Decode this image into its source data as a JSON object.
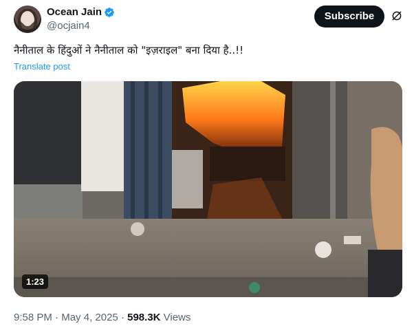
{
  "author": {
    "display_name": "Ocean Jain",
    "handle": "@ocjain4",
    "verified": true,
    "avatar_icon": "profile-photo"
  },
  "actions": {
    "subscribe_label": "Subscribe",
    "grok_icon": "grok-slash-circle-icon"
  },
  "tweet": {
    "text": "नैनीताल के हिंदुओं ने नैनीताल को \"इज़राइल\" बना दिया है..!!",
    "translate_label": "Translate post"
  },
  "media": {
    "type": "video",
    "duration": "1:23"
  },
  "meta": {
    "time": "9:58 PM",
    "date": "May 4, 2025",
    "separator": "·",
    "views_count": "598.3K",
    "views_label": "Views"
  },
  "colors": {
    "link": "#1d9bf0",
    "verified": "#1d9bf0",
    "text": "#0f1419",
    "secondary": "#536471",
    "button_bg": "#0f1419"
  }
}
